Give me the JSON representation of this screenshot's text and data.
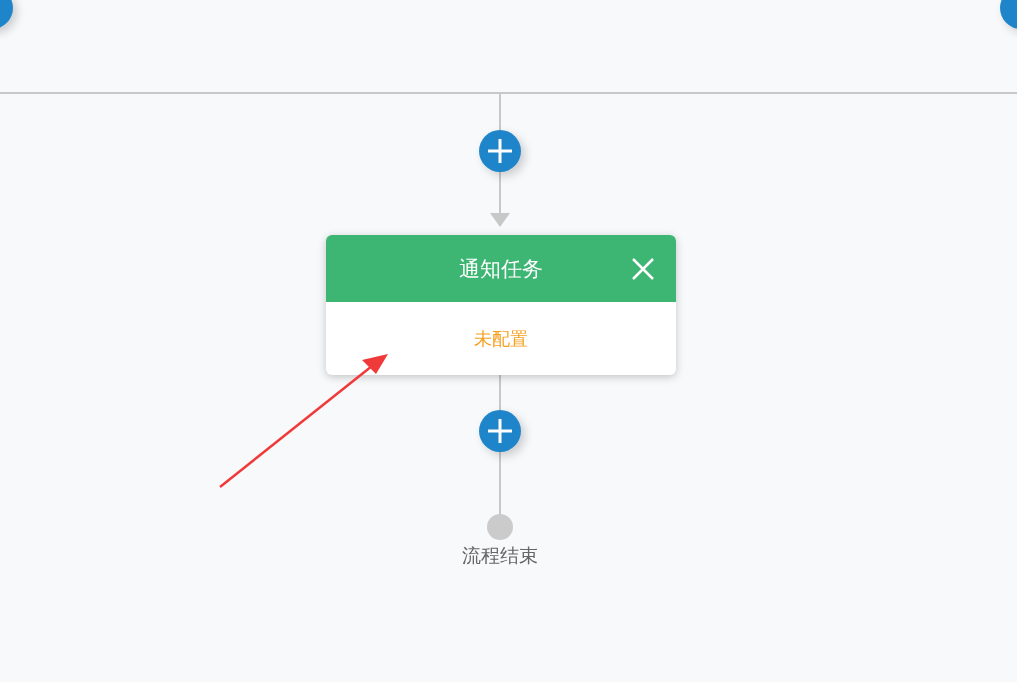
{
  "node": {
    "title": "通知任务",
    "status": "未配置"
  },
  "end": {
    "label": "流程结束"
  }
}
